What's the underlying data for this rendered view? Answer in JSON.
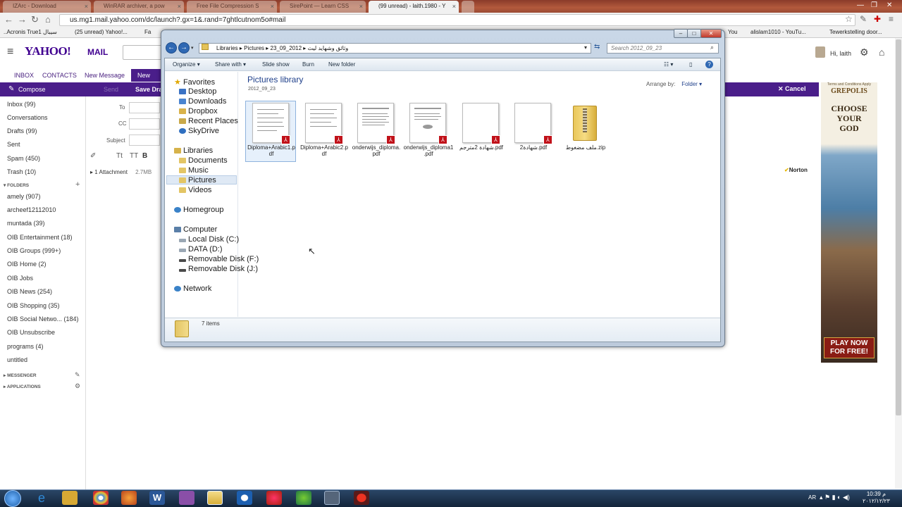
{
  "browser": {
    "tabs": [
      {
        "label": "IZArc - Download",
        "active": false
      },
      {
        "label": "WinRAR archiver, a pow",
        "active": false
      },
      {
        "label": "Free File Compression S",
        "active": false
      },
      {
        "label": "SirePoint — Learn CSS",
        "active": false
      },
      {
        "label": "(99 unread) - laith.1980 - Y",
        "active": true
      }
    ],
    "url": "us.mg1.mail.yahoo.com/dc/launch?.gx=1&.rand=7ghtlcutnom5o#mail",
    "bookmarks": [
      "..Acronis True1 سيبال",
      "(25 unread) Yahoo!...",
      "Fa",
      "You",
      "alislam1010 - YouTu...",
      "Tewerkstelling door..."
    ]
  },
  "yahoo": {
    "logo": "YAHOO!",
    "mail": "MAIL",
    "greeting": "Hi, laith",
    "nav": {
      "inbox": "INBOX",
      "contacts": "CONTACTS",
      "new_message": "New Message",
      "new_mes_tab": "New Mes"
    },
    "compose_bar": {
      "compose": "Compose",
      "send": "Send",
      "save_draft": "Save Draft",
      "cancel": "Cancel"
    },
    "fields": {
      "to": "To",
      "cc": "CC",
      "subject": "Subject"
    },
    "attachment": {
      "label": "1 Attachment",
      "size": "2.7MB"
    },
    "folders_main": [
      {
        "label": "Inbox (99)"
      },
      {
        "label": "Conversations"
      },
      {
        "label": "Drafts (99)"
      },
      {
        "label": "Sent"
      },
      {
        "label": "Spam (450)"
      },
      {
        "label": "Trash (10)"
      }
    ],
    "folders_header": "FOLDERS",
    "folders": [
      "amely (907)",
      "archeef12112010",
      "muntada (39)",
      "OIB Entertainment (18)",
      "OIB Groups (999+)",
      "OIB Home (2)",
      "OIB Jobs",
      "OIB News (254)",
      "OIB Shopping (35)",
      "OIB Social Netwo... (184)",
      "OIB Unsubscribe",
      "programs (4)",
      "untitled"
    ],
    "messenger": "MESSENGER",
    "applications": "APPLICATIONS",
    "norton": "Norton",
    "ad": {
      "top": "Terms and Conditions Apply",
      "brand": "GREPOLIS",
      "tagline": "CHOOSE YOUR GOD",
      "cta": "PLAY NOW FOR FREE!"
    }
  },
  "explorer": {
    "breadcrumb": [
      "Libraries",
      "Pictures",
      "وثائق وشهايد ليث",
      "2012_09_23"
    ],
    "search_placeholder": "Search 2012_09_23",
    "commands": [
      "Organize",
      "Share with",
      "Slide show",
      "Burn",
      "New folder"
    ],
    "nav": {
      "favorites_header": "Favorites",
      "favorites": [
        "Desktop",
        "Downloads",
        "Dropbox",
        "Recent Places",
        "SkyDrive"
      ],
      "libraries_header": "Libraries",
      "libraries": [
        "Documents",
        "Music",
        "Pictures",
        "Videos"
      ],
      "homegroup": "Homegroup",
      "computer_header": "Computer",
      "drives": [
        "Local Disk (C:)",
        "DATA (D:)",
        "Removable Disk (F:)",
        "Removable Disk (J:)"
      ],
      "network": "Network"
    },
    "library_title": "Pictures library",
    "library_sub": "2012_09_23",
    "arrange_label": "Arrange by:",
    "arrange_value": "Folder",
    "files": [
      {
        "name": "Diploma+Arabic1.pdf",
        "kind": "pdf"
      },
      {
        "name": "Diploma+Arabic2.pdf",
        "kind": "pdf"
      },
      {
        "name": "onderwijs_diploma.pdf",
        "kind": "pdf"
      },
      {
        "name": "onderwijs_diploma1.pdf",
        "kind": "pdf"
      },
      {
        "name": "شهادة 2مترجم.pdf",
        "kind": "pdf"
      },
      {
        "name": "شهادة2.pdf",
        "kind": "pdf"
      },
      {
        "name": "ملف مضغوط.zip",
        "kind": "zip"
      }
    ],
    "status": "7 items"
  },
  "taskbar": {
    "lang": "AR",
    "time": "10:39 م",
    "date": "٢٠١٢/١٢/٢٣"
  }
}
